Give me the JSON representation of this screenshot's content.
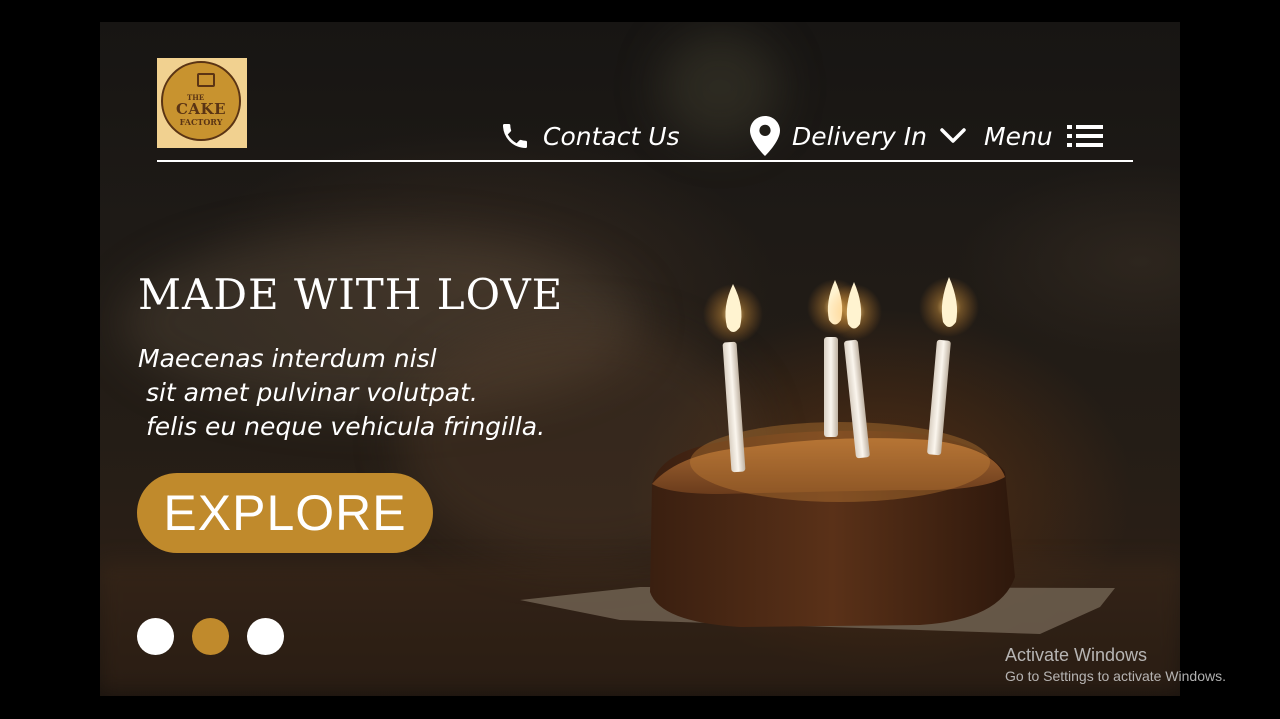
{
  "brand": {
    "logo_the": "THE",
    "logo_cake": "CAKE",
    "logo_factory": "FACTORY"
  },
  "nav": {
    "contact_label": "Contact Us",
    "delivery_label": "Delivery In",
    "menu_label": "Menu",
    "icons": {
      "contact": "phone-icon",
      "delivery": "location-pin-icon",
      "dropdown": "chevron-down-icon",
      "menu": "list-icon"
    }
  },
  "hero": {
    "headline": "MADE WITH LOVE",
    "lines": [
      "Maecenas interdum nisl",
      " sit amet pulvinar volutpat.",
      " felis eu neque vehicula fringilla."
    ],
    "cta_label": "EXPLORE"
  },
  "carousel": {
    "slide_count": 3,
    "active_index": 1
  },
  "colors": {
    "accent": "#c08a2c",
    "text": "#ffffff",
    "background": "#000000"
  },
  "os_watermark": {
    "title": "Activate Windows",
    "subtitle": "Go to Settings to activate Windows."
  }
}
